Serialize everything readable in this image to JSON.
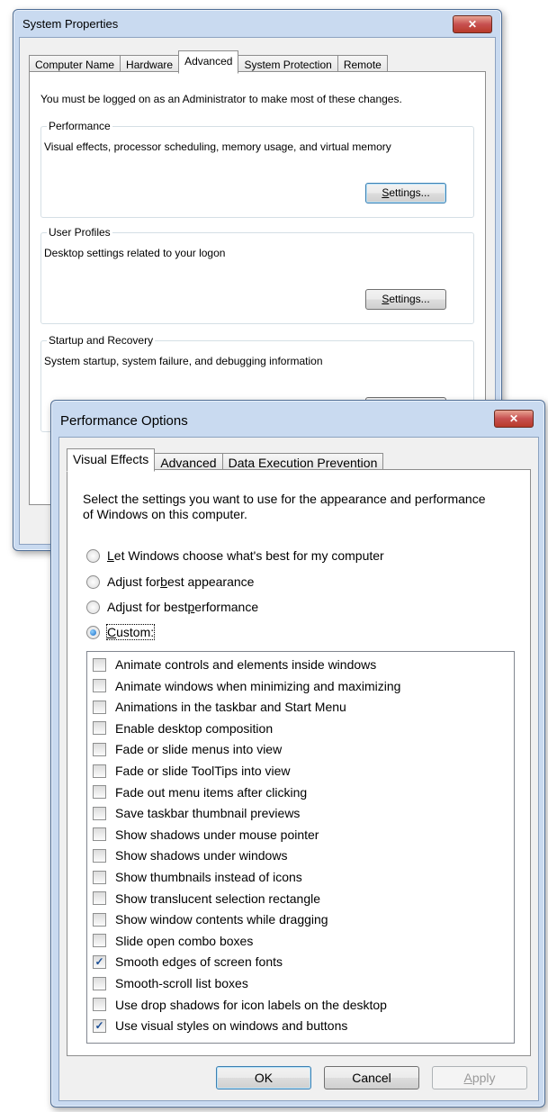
{
  "system_properties": {
    "title": "System Properties",
    "close_label": "✕",
    "tabs": [
      "Computer Name",
      "Hardware",
      "Advanced",
      "System Protection",
      "Remote"
    ],
    "active_tab": "Advanced",
    "admin_note": "You must be logged on as an Administrator to make most of these changes.",
    "groups": [
      {
        "label": "Performance",
        "desc": "Visual effects, processor scheduling, memory usage, and virtual memory",
        "button_prefix": "S",
        "button_rest": "ettings..."
      },
      {
        "label": "User Profiles",
        "desc": "Desktop settings related to your logon",
        "button_prefix": "S",
        "button_rest": "ettings..."
      },
      {
        "label": "Startup and Recovery",
        "desc": "System startup, system failure, and debugging information"
      }
    ]
  },
  "performance_options": {
    "title": "Performance Options",
    "close_label": "✕",
    "tabs": [
      "Visual Effects",
      "Advanced",
      "Data Execution Prevention"
    ],
    "active_tab": "Visual Effects",
    "description": "Select the settings you want to use for the appearance and performance of Windows on this computer.",
    "radios": [
      {
        "pre": "",
        "u": "L",
        "post": "et Windows choose what's best for my computer",
        "checked": false
      },
      {
        "pre": "Adjust for ",
        "u": "b",
        "post": "est appearance",
        "checked": false
      },
      {
        "pre": "Adjust for best ",
        "u": "p",
        "post": "erformance",
        "checked": false
      },
      {
        "pre": "",
        "u": "C",
        "post": "ustom:",
        "checked": true
      }
    ],
    "effects": [
      {
        "label": "Animate controls and elements inside windows",
        "checked": false
      },
      {
        "label": "Animate windows when minimizing and maximizing",
        "checked": false
      },
      {
        "label": "Animations in the taskbar and Start Menu",
        "checked": false
      },
      {
        "label": "Enable desktop composition",
        "checked": false
      },
      {
        "label": "Fade or slide menus into view",
        "checked": false
      },
      {
        "label": "Fade or slide ToolTips into view",
        "checked": false
      },
      {
        "label": "Fade out menu items after clicking",
        "checked": false
      },
      {
        "label": "Save taskbar thumbnail previews",
        "checked": false
      },
      {
        "label": "Show shadows under mouse pointer",
        "checked": false
      },
      {
        "label": "Show shadows under windows",
        "checked": false
      },
      {
        "label": "Show thumbnails instead of icons",
        "checked": false
      },
      {
        "label": "Show translucent selection rectangle",
        "checked": false
      },
      {
        "label": "Show window contents while dragging",
        "checked": false
      },
      {
        "label": "Slide open combo boxes",
        "checked": false
      },
      {
        "label": "Smooth edges of screen fonts",
        "checked": true
      },
      {
        "label": "Smooth-scroll list boxes",
        "checked": false
      },
      {
        "label": "Use drop shadows for icon labels on the desktop",
        "checked": false
      },
      {
        "label": "Use visual styles on windows and buttons",
        "checked": true
      }
    ],
    "buttons": {
      "ok": "OK",
      "cancel": "Cancel",
      "apply_u": "A",
      "apply_rest": "pply"
    }
  }
}
